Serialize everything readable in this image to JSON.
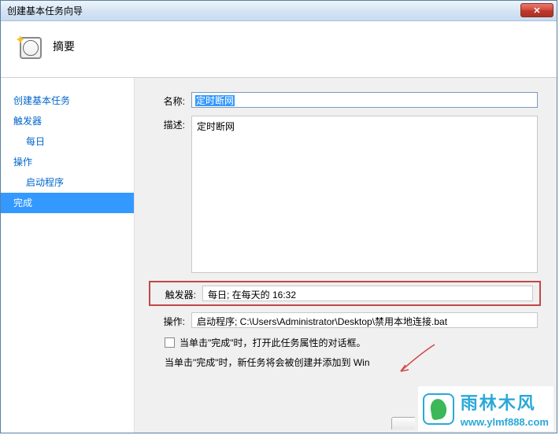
{
  "window": {
    "title": "创建基本任务向导"
  },
  "header": {
    "title": "摘要"
  },
  "sidebar": {
    "items": [
      {
        "label": "创建基本任务",
        "indent": false
      },
      {
        "label": "触发器",
        "indent": false
      },
      {
        "label": "每日",
        "indent": true
      },
      {
        "label": "操作",
        "indent": false
      },
      {
        "label": "启动程序",
        "indent": true
      },
      {
        "label": "完成",
        "indent": false,
        "selected": true
      }
    ]
  },
  "form": {
    "name_label": "名称:",
    "name_value": "定时断网",
    "desc_label": "描述:",
    "desc_value": "定时断网",
    "trigger_label": "触发器:",
    "trigger_value": "每日; 在每天的 16:32",
    "action_label": "操作:",
    "action_value": "启动程序; C:\\Users\\Administrator\\Desktop\\禁用本地连接.bat",
    "checkbox_label": "当单击\"完成\"时，打开此任务属性的对话框。",
    "note_text": "当单击\"完成\"时，新任务将会被创建并添加到 Win"
  },
  "watermark": {
    "cn": "雨林木风",
    "en": "www.ylmf888.com"
  }
}
